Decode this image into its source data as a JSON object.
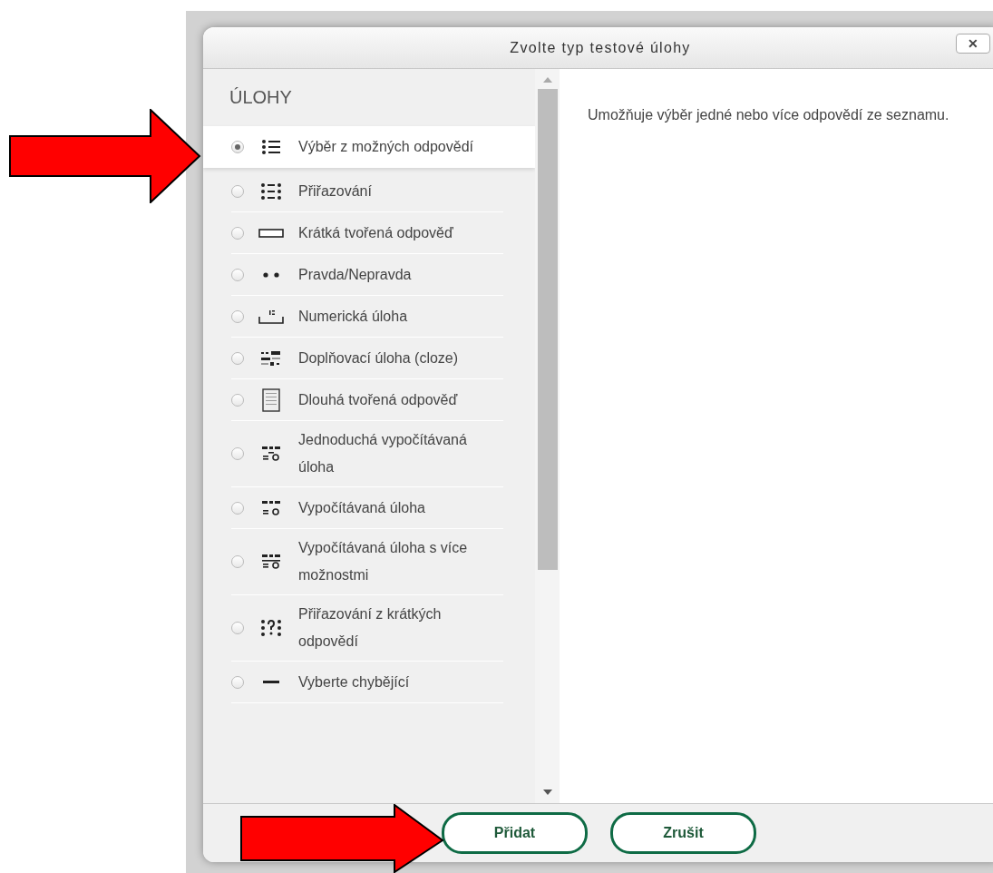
{
  "dialog": {
    "title": "Zvolte typ testové úlohy",
    "close_label": "✕"
  },
  "list": {
    "heading": "ÚLOHY",
    "items": [
      {
        "kind": "multichoice",
        "label": "Výběr z možných odpovědí",
        "selected": true
      },
      {
        "kind": "match",
        "label": "Přiřazování",
        "selected": false
      },
      {
        "kind": "shortanswer",
        "label": "Krátká tvořená odpověď",
        "selected": false
      },
      {
        "kind": "truefalse",
        "label": "Pravda/Nepravda",
        "selected": false
      },
      {
        "kind": "numerical",
        "label": "Numerická úloha",
        "selected": false
      },
      {
        "kind": "cloze",
        "label": "Doplňovací úloha (cloze)",
        "selected": false
      },
      {
        "kind": "essay",
        "label": "Dlouhá tvořená odpověď",
        "selected": false
      },
      {
        "kind": "calcsimple",
        "label": "Jednoduchá vypočítávaná úloha",
        "selected": false
      },
      {
        "kind": "calculated",
        "label": "Vypočítávaná úloha",
        "selected": false
      },
      {
        "kind": "calcmulti",
        "label": "Vypočítávaná úloha s více možnostmi",
        "selected": false
      },
      {
        "kind": "randommatch",
        "label": "Přiřazování z krátkých odpovědí",
        "selected": false
      },
      {
        "kind": "gapselect",
        "label": "Vyberte chybějící",
        "selected": false
      }
    ]
  },
  "description": "Umožňuje výběr jedné nebo více odpovědí ze seznamu.",
  "buttons": [
    "Přidat",
    "Zrušit"
  ]
}
